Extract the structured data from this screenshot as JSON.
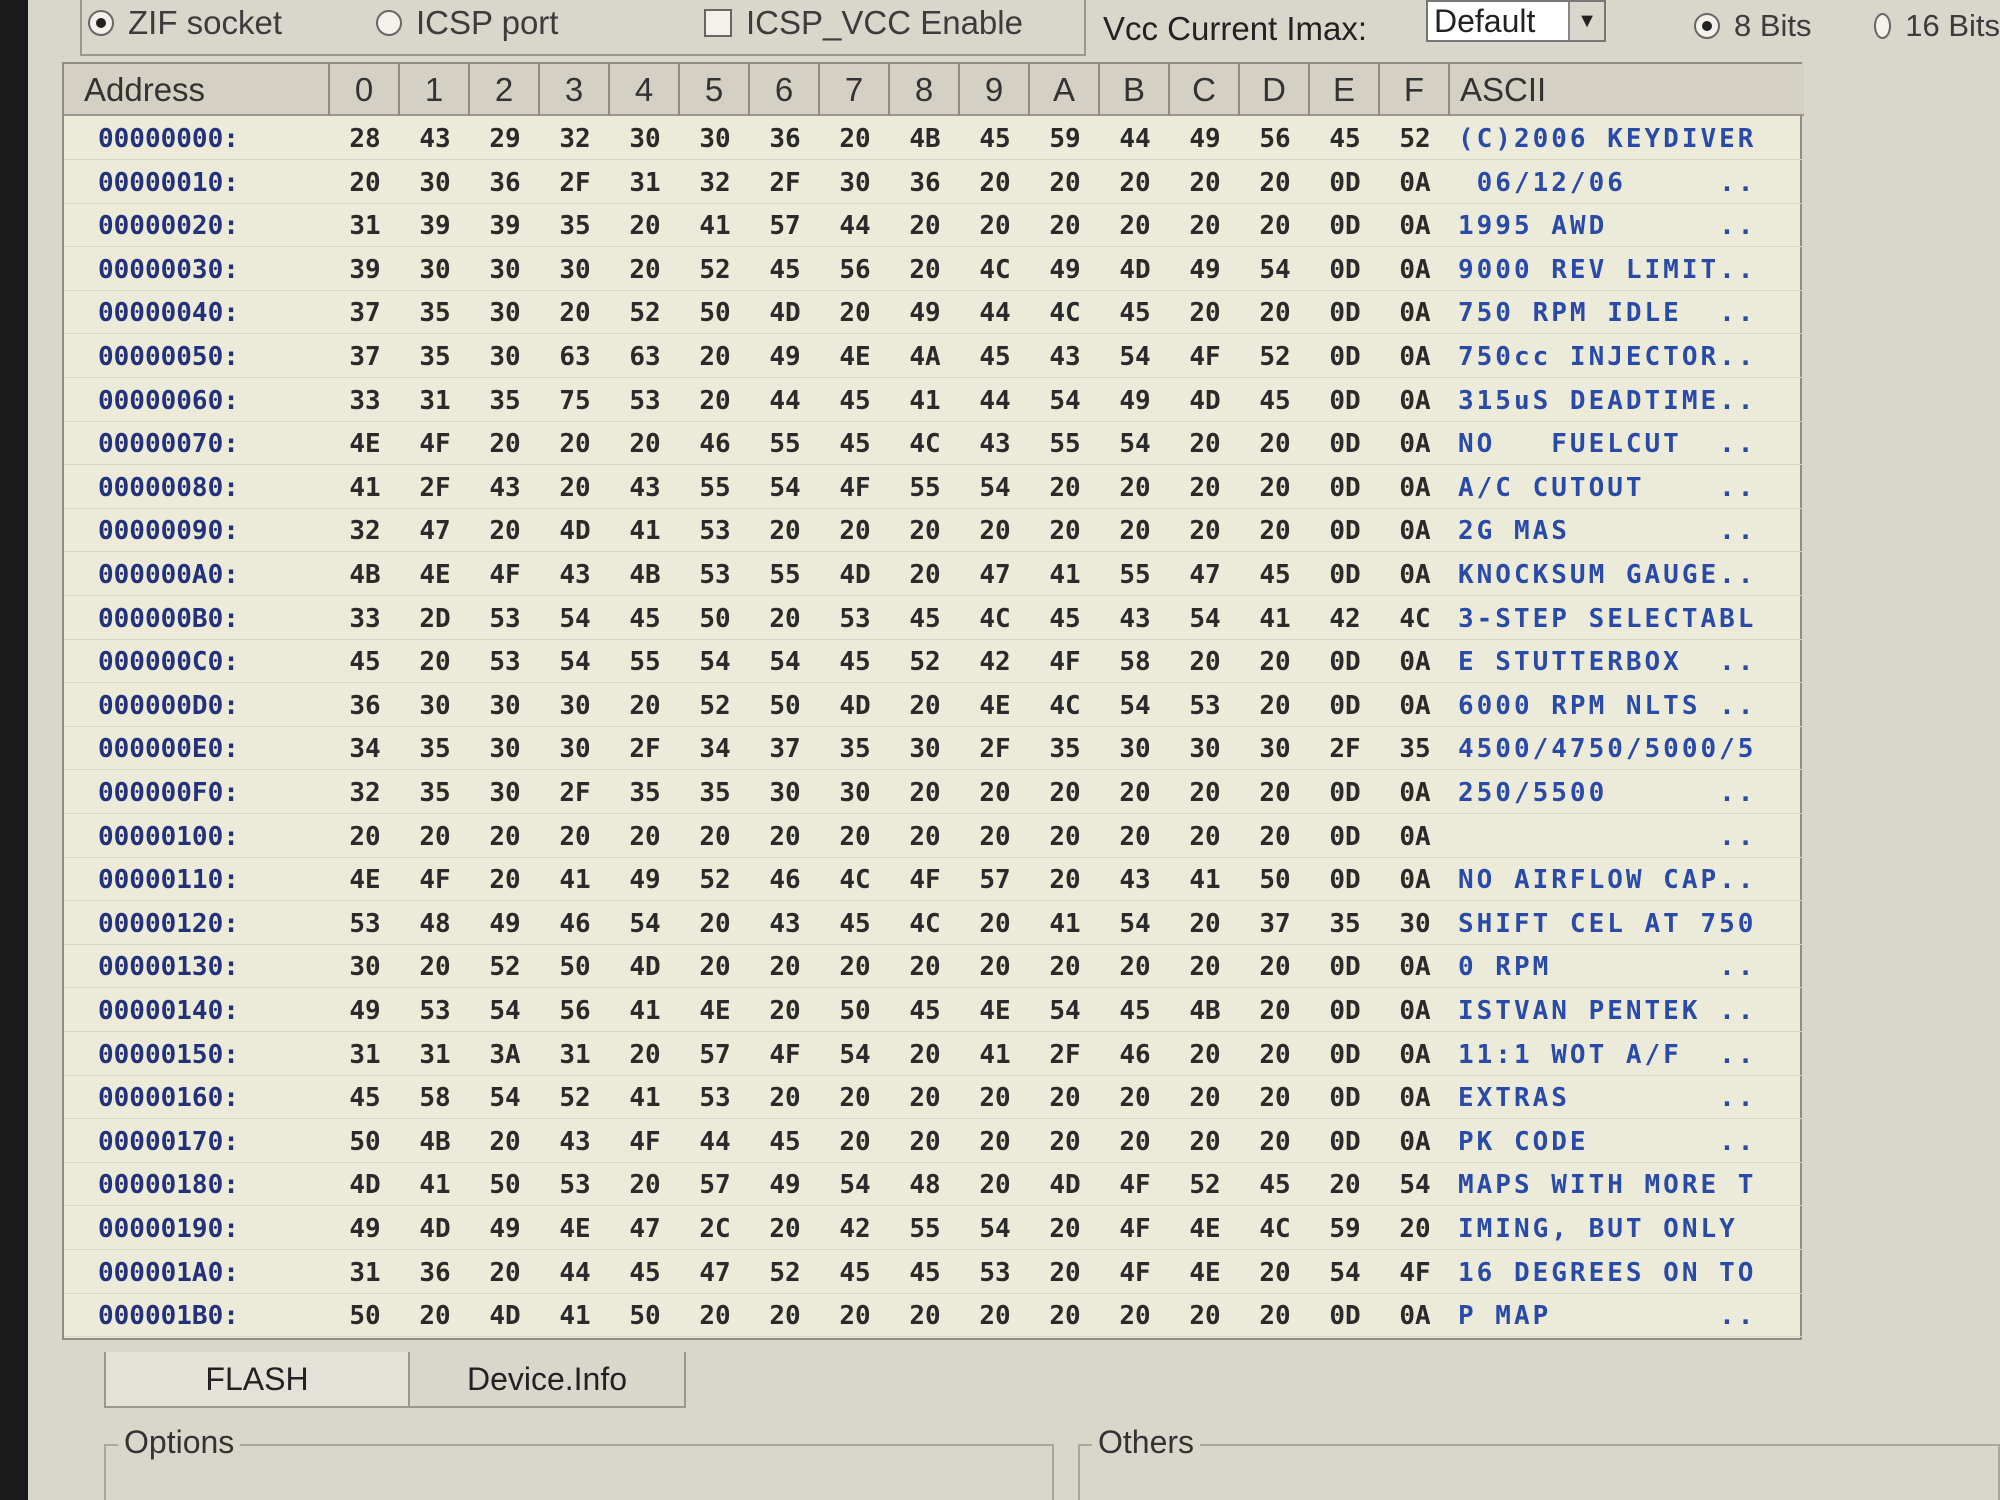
{
  "toolbar": {
    "zif_label": "ZIF socket",
    "icsp_label": "ICSP port",
    "icsp_vcc_label": "ICSP_VCC Enable",
    "vcc_label": "Vcc Current Imax:",
    "vcc_value": "Default",
    "bits8_label": "8 Bits",
    "bits16_label": "16 Bits"
  },
  "hex": {
    "address_header": "Address",
    "ascii_header": "ASCII",
    "columns": [
      "0",
      "1",
      "2",
      "3",
      "4",
      "5",
      "6",
      "7",
      "8",
      "9",
      "A",
      "B",
      "C",
      "D",
      "E",
      "F"
    ],
    "rows": [
      {
        "addr": "00000000:",
        "bytes": [
          "28",
          "43",
          "29",
          "32",
          "30",
          "30",
          "36",
          "20",
          "4B",
          "45",
          "59",
          "44",
          "49",
          "56",
          "45",
          "52"
        ],
        "ascii": "(C)2006 KEYDIVER"
      },
      {
        "addr": "00000010:",
        "bytes": [
          "20",
          "30",
          "36",
          "2F",
          "31",
          "32",
          "2F",
          "30",
          "36",
          "20",
          "20",
          "20",
          "20",
          "20",
          "0D",
          "0A"
        ],
        "ascii": " 06/12/06     .."
      },
      {
        "addr": "00000020:",
        "bytes": [
          "31",
          "39",
          "39",
          "35",
          "20",
          "41",
          "57",
          "44",
          "20",
          "20",
          "20",
          "20",
          "20",
          "20",
          "0D",
          "0A"
        ],
        "ascii": "1995 AWD      .."
      },
      {
        "addr": "00000030:",
        "bytes": [
          "39",
          "30",
          "30",
          "30",
          "20",
          "52",
          "45",
          "56",
          "20",
          "4C",
          "49",
          "4D",
          "49",
          "54",
          "0D",
          "0A"
        ],
        "ascii": "9000 REV LIMIT.."
      },
      {
        "addr": "00000040:",
        "bytes": [
          "37",
          "35",
          "30",
          "20",
          "52",
          "50",
          "4D",
          "20",
          "49",
          "44",
          "4C",
          "45",
          "20",
          "20",
          "0D",
          "0A"
        ],
        "ascii": "750 RPM IDLE  .."
      },
      {
        "addr": "00000050:",
        "bytes": [
          "37",
          "35",
          "30",
          "63",
          "63",
          "20",
          "49",
          "4E",
          "4A",
          "45",
          "43",
          "54",
          "4F",
          "52",
          "0D",
          "0A"
        ],
        "ascii": "750cc INJECTOR.."
      },
      {
        "addr": "00000060:",
        "bytes": [
          "33",
          "31",
          "35",
          "75",
          "53",
          "20",
          "44",
          "45",
          "41",
          "44",
          "54",
          "49",
          "4D",
          "45",
          "0D",
          "0A"
        ],
        "ascii": "315uS DEADTIME.."
      },
      {
        "addr": "00000070:",
        "bytes": [
          "4E",
          "4F",
          "20",
          "20",
          "20",
          "46",
          "55",
          "45",
          "4C",
          "43",
          "55",
          "54",
          "20",
          "20",
          "0D",
          "0A"
        ],
        "ascii": "NO   FUELCUT  .."
      },
      {
        "addr": "00000080:",
        "bytes": [
          "41",
          "2F",
          "43",
          "20",
          "43",
          "55",
          "54",
          "4F",
          "55",
          "54",
          "20",
          "20",
          "20",
          "20",
          "0D",
          "0A"
        ],
        "ascii": "A/C CUTOUT    .."
      },
      {
        "addr": "00000090:",
        "bytes": [
          "32",
          "47",
          "20",
          "4D",
          "41",
          "53",
          "20",
          "20",
          "20",
          "20",
          "20",
          "20",
          "20",
          "20",
          "0D",
          "0A"
        ],
        "ascii": "2G MAS        .."
      },
      {
        "addr": "000000A0:",
        "bytes": [
          "4B",
          "4E",
          "4F",
          "43",
          "4B",
          "53",
          "55",
          "4D",
          "20",
          "47",
          "41",
          "55",
          "47",
          "45",
          "0D",
          "0A"
        ],
        "ascii": "KNOCKSUM GAUGE.."
      },
      {
        "addr": "000000B0:",
        "bytes": [
          "33",
          "2D",
          "53",
          "54",
          "45",
          "50",
          "20",
          "53",
          "45",
          "4C",
          "45",
          "43",
          "54",
          "41",
          "42",
          "4C"
        ],
        "ascii": "3-STEP SELECTABL"
      },
      {
        "addr": "000000C0:",
        "bytes": [
          "45",
          "20",
          "53",
          "54",
          "55",
          "54",
          "54",
          "45",
          "52",
          "42",
          "4F",
          "58",
          "20",
          "20",
          "0D",
          "0A"
        ],
        "ascii": "E STUTTERBOX  .."
      },
      {
        "addr": "000000D0:",
        "bytes": [
          "36",
          "30",
          "30",
          "30",
          "20",
          "52",
          "50",
          "4D",
          "20",
          "4E",
          "4C",
          "54",
          "53",
          "20",
          "0D",
          "0A"
        ],
        "ascii": "6000 RPM NLTS .."
      },
      {
        "addr": "000000E0:",
        "bytes": [
          "34",
          "35",
          "30",
          "30",
          "2F",
          "34",
          "37",
          "35",
          "30",
          "2F",
          "35",
          "30",
          "30",
          "30",
          "2F",
          "35"
        ],
        "ascii": "4500/4750/5000/5"
      },
      {
        "addr": "000000F0:",
        "bytes": [
          "32",
          "35",
          "30",
          "2F",
          "35",
          "35",
          "30",
          "30",
          "20",
          "20",
          "20",
          "20",
          "20",
          "20",
          "0D",
          "0A"
        ],
        "ascii": "250/5500      .."
      },
      {
        "addr": "00000100:",
        "bytes": [
          "20",
          "20",
          "20",
          "20",
          "20",
          "20",
          "20",
          "20",
          "20",
          "20",
          "20",
          "20",
          "20",
          "20",
          "0D",
          "0A"
        ],
        "ascii": "              .."
      },
      {
        "addr": "00000110:",
        "bytes": [
          "4E",
          "4F",
          "20",
          "41",
          "49",
          "52",
          "46",
          "4C",
          "4F",
          "57",
          "20",
          "43",
          "41",
          "50",
          "0D",
          "0A"
        ],
        "ascii": "NO AIRFLOW CAP.."
      },
      {
        "addr": "00000120:",
        "bytes": [
          "53",
          "48",
          "49",
          "46",
          "54",
          "20",
          "43",
          "45",
          "4C",
          "20",
          "41",
          "54",
          "20",
          "37",
          "35",
          "30"
        ],
        "ascii": "SHIFT CEL AT 750"
      },
      {
        "addr": "00000130:",
        "bytes": [
          "30",
          "20",
          "52",
          "50",
          "4D",
          "20",
          "20",
          "20",
          "20",
          "20",
          "20",
          "20",
          "20",
          "20",
          "0D",
          "0A"
        ],
        "ascii": "0 RPM         .."
      },
      {
        "addr": "00000140:",
        "bytes": [
          "49",
          "53",
          "54",
          "56",
          "41",
          "4E",
          "20",
          "50",
          "45",
          "4E",
          "54",
          "45",
          "4B",
          "20",
          "0D",
          "0A"
        ],
        "ascii": "ISTVAN PENTEK .."
      },
      {
        "addr": "00000150:",
        "bytes": [
          "31",
          "31",
          "3A",
          "31",
          "20",
          "57",
          "4F",
          "54",
          "20",
          "41",
          "2F",
          "46",
          "20",
          "20",
          "0D",
          "0A"
        ],
        "ascii": "11:1 WOT A/F  .."
      },
      {
        "addr": "00000160:",
        "bytes": [
          "45",
          "58",
          "54",
          "52",
          "41",
          "53",
          "20",
          "20",
          "20",
          "20",
          "20",
          "20",
          "20",
          "20",
          "0D",
          "0A"
        ],
        "ascii": "EXTRAS        .."
      },
      {
        "addr": "00000170:",
        "bytes": [
          "50",
          "4B",
          "20",
          "43",
          "4F",
          "44",
          "45",
          "20",
          "20",
          "20",
          "20",
          "20",
          "20",
          "20",
          "0D",
          "0A"
        ],
        "ascii": "PK CODE       .."
      },
      {
        "addr": "00000180:",
        "bytes": [
          "4D",
          "41",
          "50",
          "53",
          "20",
          "57",
          "49",
          "54",
          "48",
          "20",
          "4D",
          "4F",
          "52",
          "45",
          "20",
          "54"
        ],
        "ascii": "MAPS WITH MORE T"
      },
      {
        "addr": "00000190:",
        "bytes": [
          "49",
          "4D",
          "49",
          "4E",
          "47",
          "2C",
          "20",
          "42",
          "55",
          "54",
          "20",
          "4F",
          "4E",
          "4C",
          "59",
          "20"
        ],
        "ascii": "IMING, BUT ONLY "
      },
      {
        "addr": "000001A0:",
        "bytes": [
          "31",
          "36",
          "20",
          "44",
          "45",
          "47",
          "52",
          "45",
          "45",
          "53",
          "20",
          "4F",
          "4E",
          "20",
          "54",
          "4F"
        ],
        "ascii": "16 DEGREES ON TO"
      },
      {
        "addr": "000001B0:",
        "bytes": [
          "50",
          "20",
          "4D",
          "41",
          "50",
          "20",
          "20",
          "20",
          "20",
          "20",
          "20",
          "20",
          "20",
          "20",
          "0D",
          "0A"
        ],
        "ascii": "P MAP         .."
      }
    ]
  },
  "tabs": {
    "flash": "FLASH",
    "device_info": "Device.Info"
  },
  "groups": {
    "options": "Options",
    "others": "Others"
  }
}
